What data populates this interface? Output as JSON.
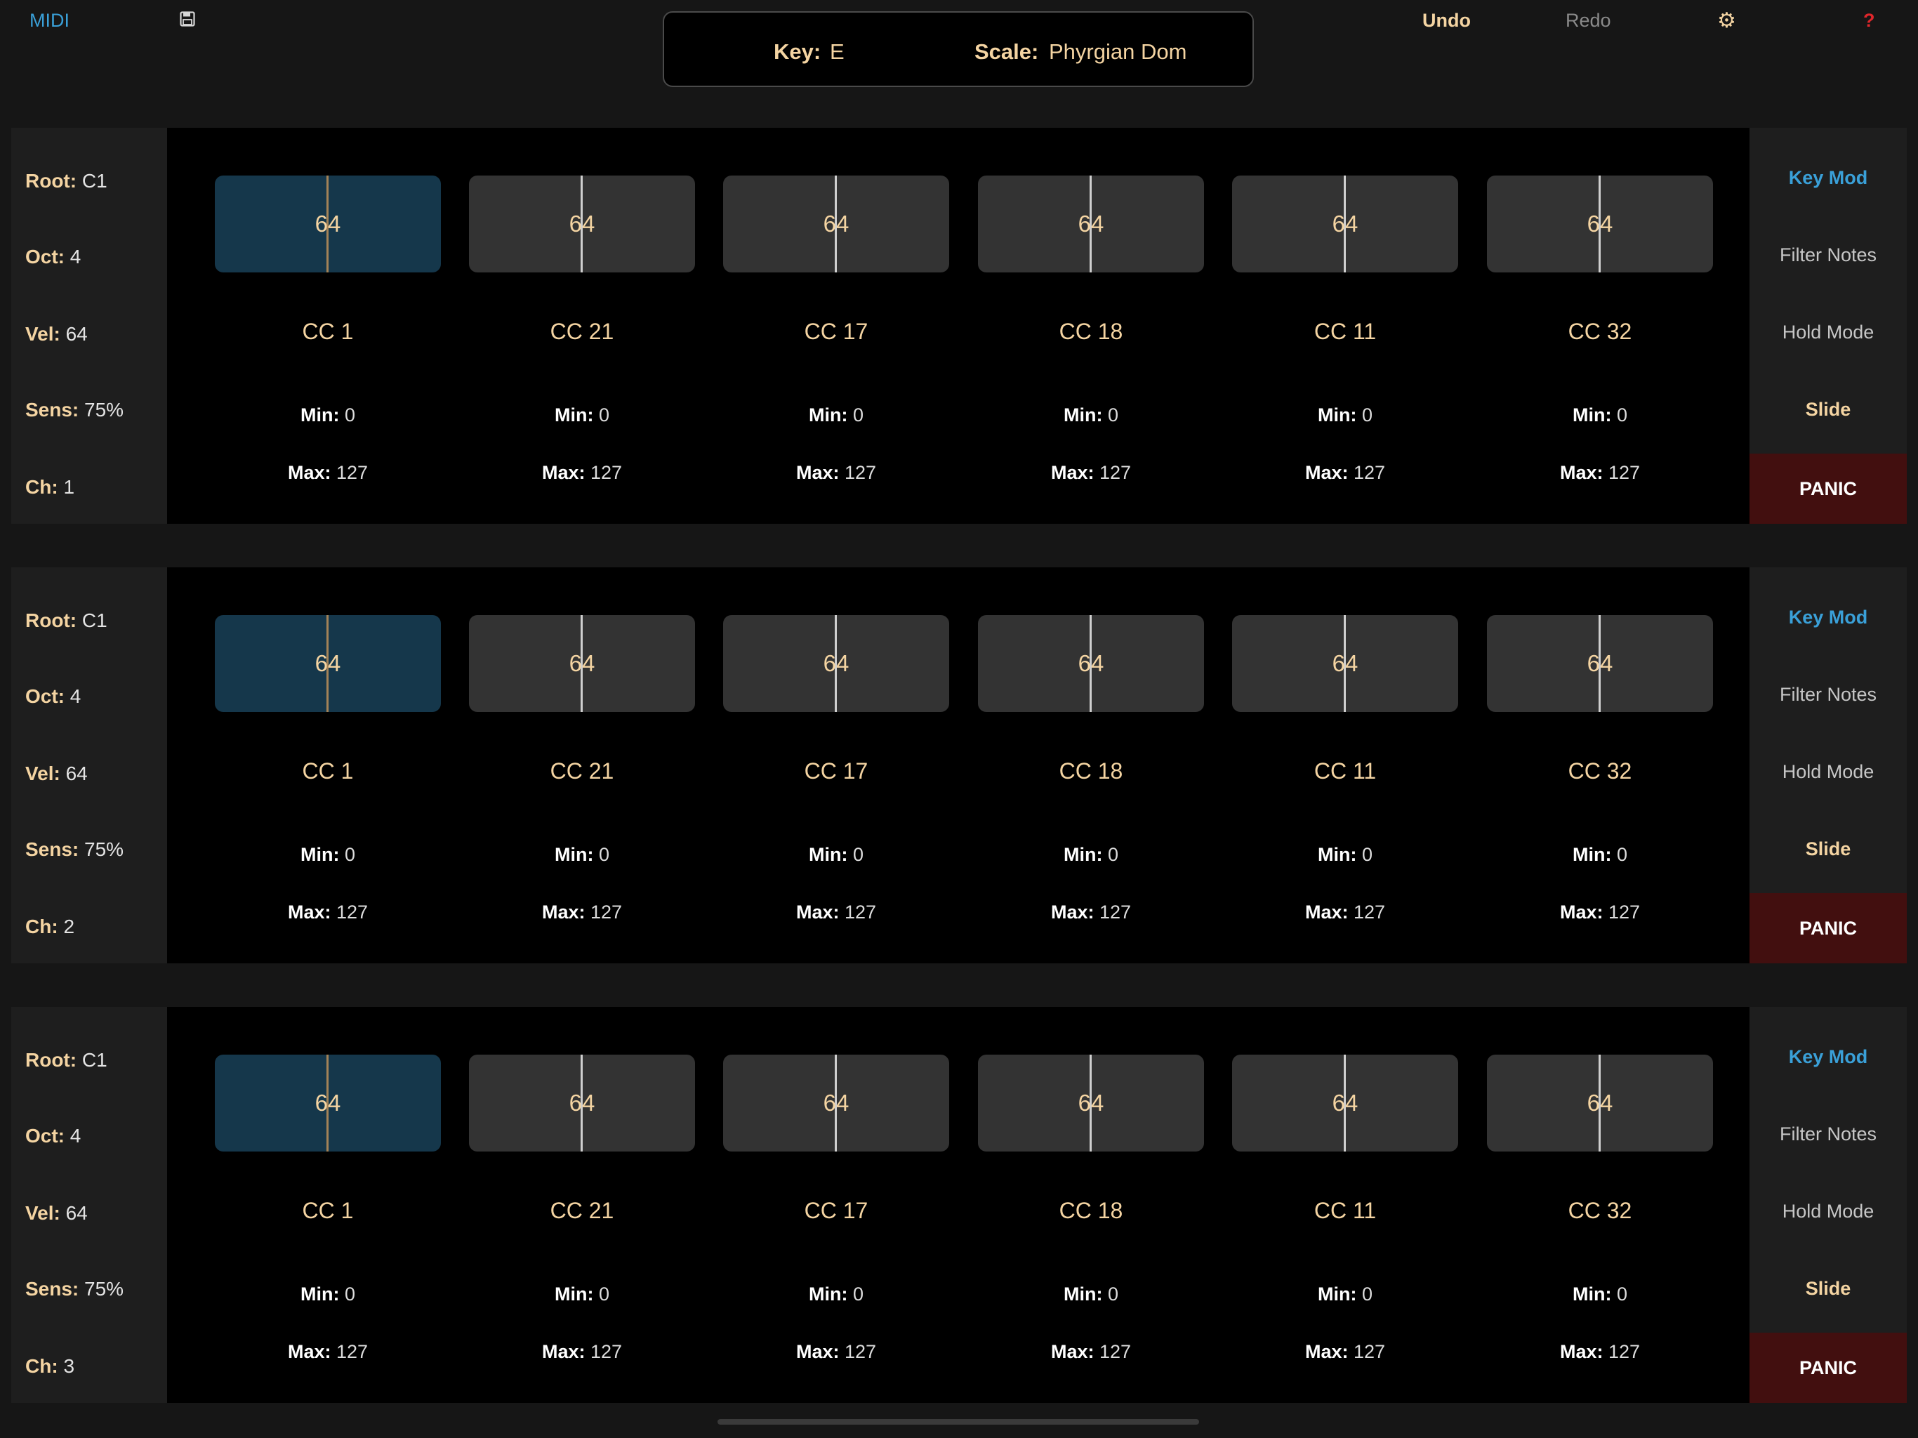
{
  "topbar": {
    "midi_label": "MIDI",
    "undo_label": "Undo",
    "redo_label": "Redo",
    "save_icon": "floppy-disk-icon",
    "settings_icon": "gear-icon",
    "help_label": "?"
  },
  "keybox": {
    "key_label": "Key:",
    "key_value": "E",
    "scale_label": "Scale:",
    "scale_value": "Phyrgian Dom"
  },
  "labels": {
    "root": "Root:",
    "oct": "Oct:",
    "vel": "Vel:",
    "sens": "Sens:",
    "ch": "Ch:",
    "min": "Min:",
    "max": "Max:"
  },
  "colors": {
    "accent_gold": "#f4d4a2",
    "accent_blue": "#3aa0d8",
    "panic_red": "#420f0f",
    "active_slider": "#15374b"
  },
  "rows": [
    {
      "root": "C1",
      "oct": "4",
      "vel": "64",
      "sens": "75%",
      "ch": "1",
      "buttons": [
        "Key Mod",
        "Filter Notes",
        "Hold Mode",
        "Slide",
        "PANIC"
      ],
      "controls": [
        {
          "value": "64",
          "name": "CC 1",
          "min": "0",
          "max": "127"
        },
        {
          "value": "64",
          "name": "CC 21",
          "min": "0",
          "max": "127"
        },
        {
          "value": "64",
          "name": "CC 17",
          "min": "0",
          "max": "127"
        },
        {
          "value": "64",
          "name": "CC 18",
          "min": "0",
          "max": "127"
        },
        {
          "value": "64",
          "name": "CC 11",
          "min": "0",
          "max": "127"
        },
        {
          "value": "64",
          "name": "CC 32",
          "min": "0",
          "max": "127"
        }
      ]
    },
    {
      "root": "C1",
      "oct": "4",
      "vel": "64",
      "sens": "75%",
      "ch": "2",
      "buttons": [
        "Key Mod",
        "Filter Notes",
        "Hold Mode",
        "Slide",
        "PANIC"
      ],
      "controls": [
        {
          "value": "64",
          "name": "CC 1",
          "min": "0",
          "max": "127"
        },
        {
          "value": "64",
          "name": "CC 21",
          "min": "0",
          "max": "127"
        },
        {
          "value": "64",
          "name": "CC 17",
          "min": "0",
          "max": "127"
        },
        {
          "value": "64",
          "name": "CC 18",
          "min": "0",
          "max": "127"
        },
        {
          "value": "64",
          "name": "CC 11",
          "min": "0",
          "max": "127"
        },
        {
          "value": "64",
          "name": "CC 32",
          "min": "0",
          "max": "127"
        }
      ]
    },
    {
      "root": "C1",
      "oct": "4",
      "vel": "64",
      "sens": "75%",
      "ch": "3",
      "buttons": [
        "Key Mod",
        "Filter Notes",
        "Hold Mode",
        "Slide",
        "PANIC"
      ],
      "controls": [
        {
          "value": "64",
          "name": "CC 1",
          "min": "0",
          "max": "127"
        },
        {
          "value": "64",
          "name": "CC 21",
          "min": "0",
          "max": "127"
        },
        {
          "value": "64",
          "name": "CC 17",
          "min": "0",
          "max": "127"
        },
        {
          "value": "64",
          "name": "CC 18",
          "min": "0",
          "max": "127"
        },
        {
          "value": "64",
          "name": "CC 11",
          "min": "0",
          "max": "127"
        },
        {
          "value": "64",
          "name": "CC 32",
          "min": "0",
          "max": "127"
        }
      ]
    }
  ]
}
